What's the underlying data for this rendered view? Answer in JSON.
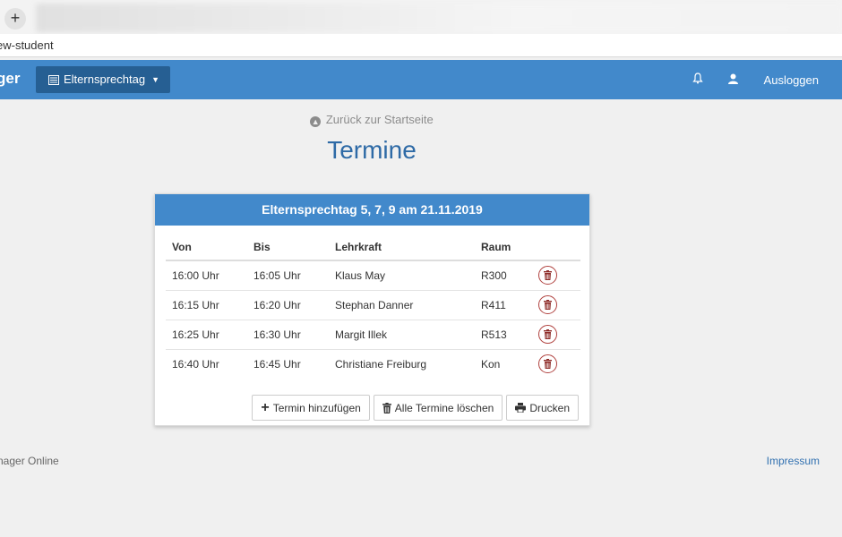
{
  "browser": {
    "new_tab_label": "+",
    "url_fragment": "ew-student"
  },
  "navbar": {
    "brand": "ger",
    "dropdown_label": "Elternsprechtag",
    "icons": [
      "bell-icon",
      "user-icon"
    ],
    "logout_label": "Ausloggen"
  },
  "content": {
    "back_link": "Zurück zur Startseite",
    "title": "Termine",
    "card_title": "Elternsprechtag 5, 7, 9 am 21.11.2019",
    "columns": [
      "Von",
      "Bis",
      "Lehrkraft",
      "Raum"
    ],
    "rows": [
      {
        "von": "16:00 Uhr",
        "bis": "16:05 Uhr",
        "lehrkraft": "Klaus May",
        "raum": "R300"
      },
      {
        "von": "16:15 Uhr",
        "bis": "16:20 Uhr",
        "lehrkraft": "Stephan Danner",
        "raum": "R411"
      },
      {
        "von": "16:25 Uhr",
        "bis": "16:30 Uhr",
        "lehrkraft": "Margit Illek",
        "raum": "R513"
      },
      {
        "von": "16:40 Uhr",
        "bis": "16:45 Uhr",
        "lehrkraft": "Christiane Freiburg",
        "raum": "Kon"
      }
    ],
    "buttons": {
      "add": "Termin hinzufügen",
      "delete_all": "Alle Termine löschen",
      "print": "Drucken"
    }
  },
  "footer": {
    "left": "nager Online",
    "right": "Impressum"
  },
  "colors": {
    "navbar": "#4289cb",
    "dropdown": "#265f93",
    "title": "#2e6aa6",
    "delete": "#b0413e"
  }
}
